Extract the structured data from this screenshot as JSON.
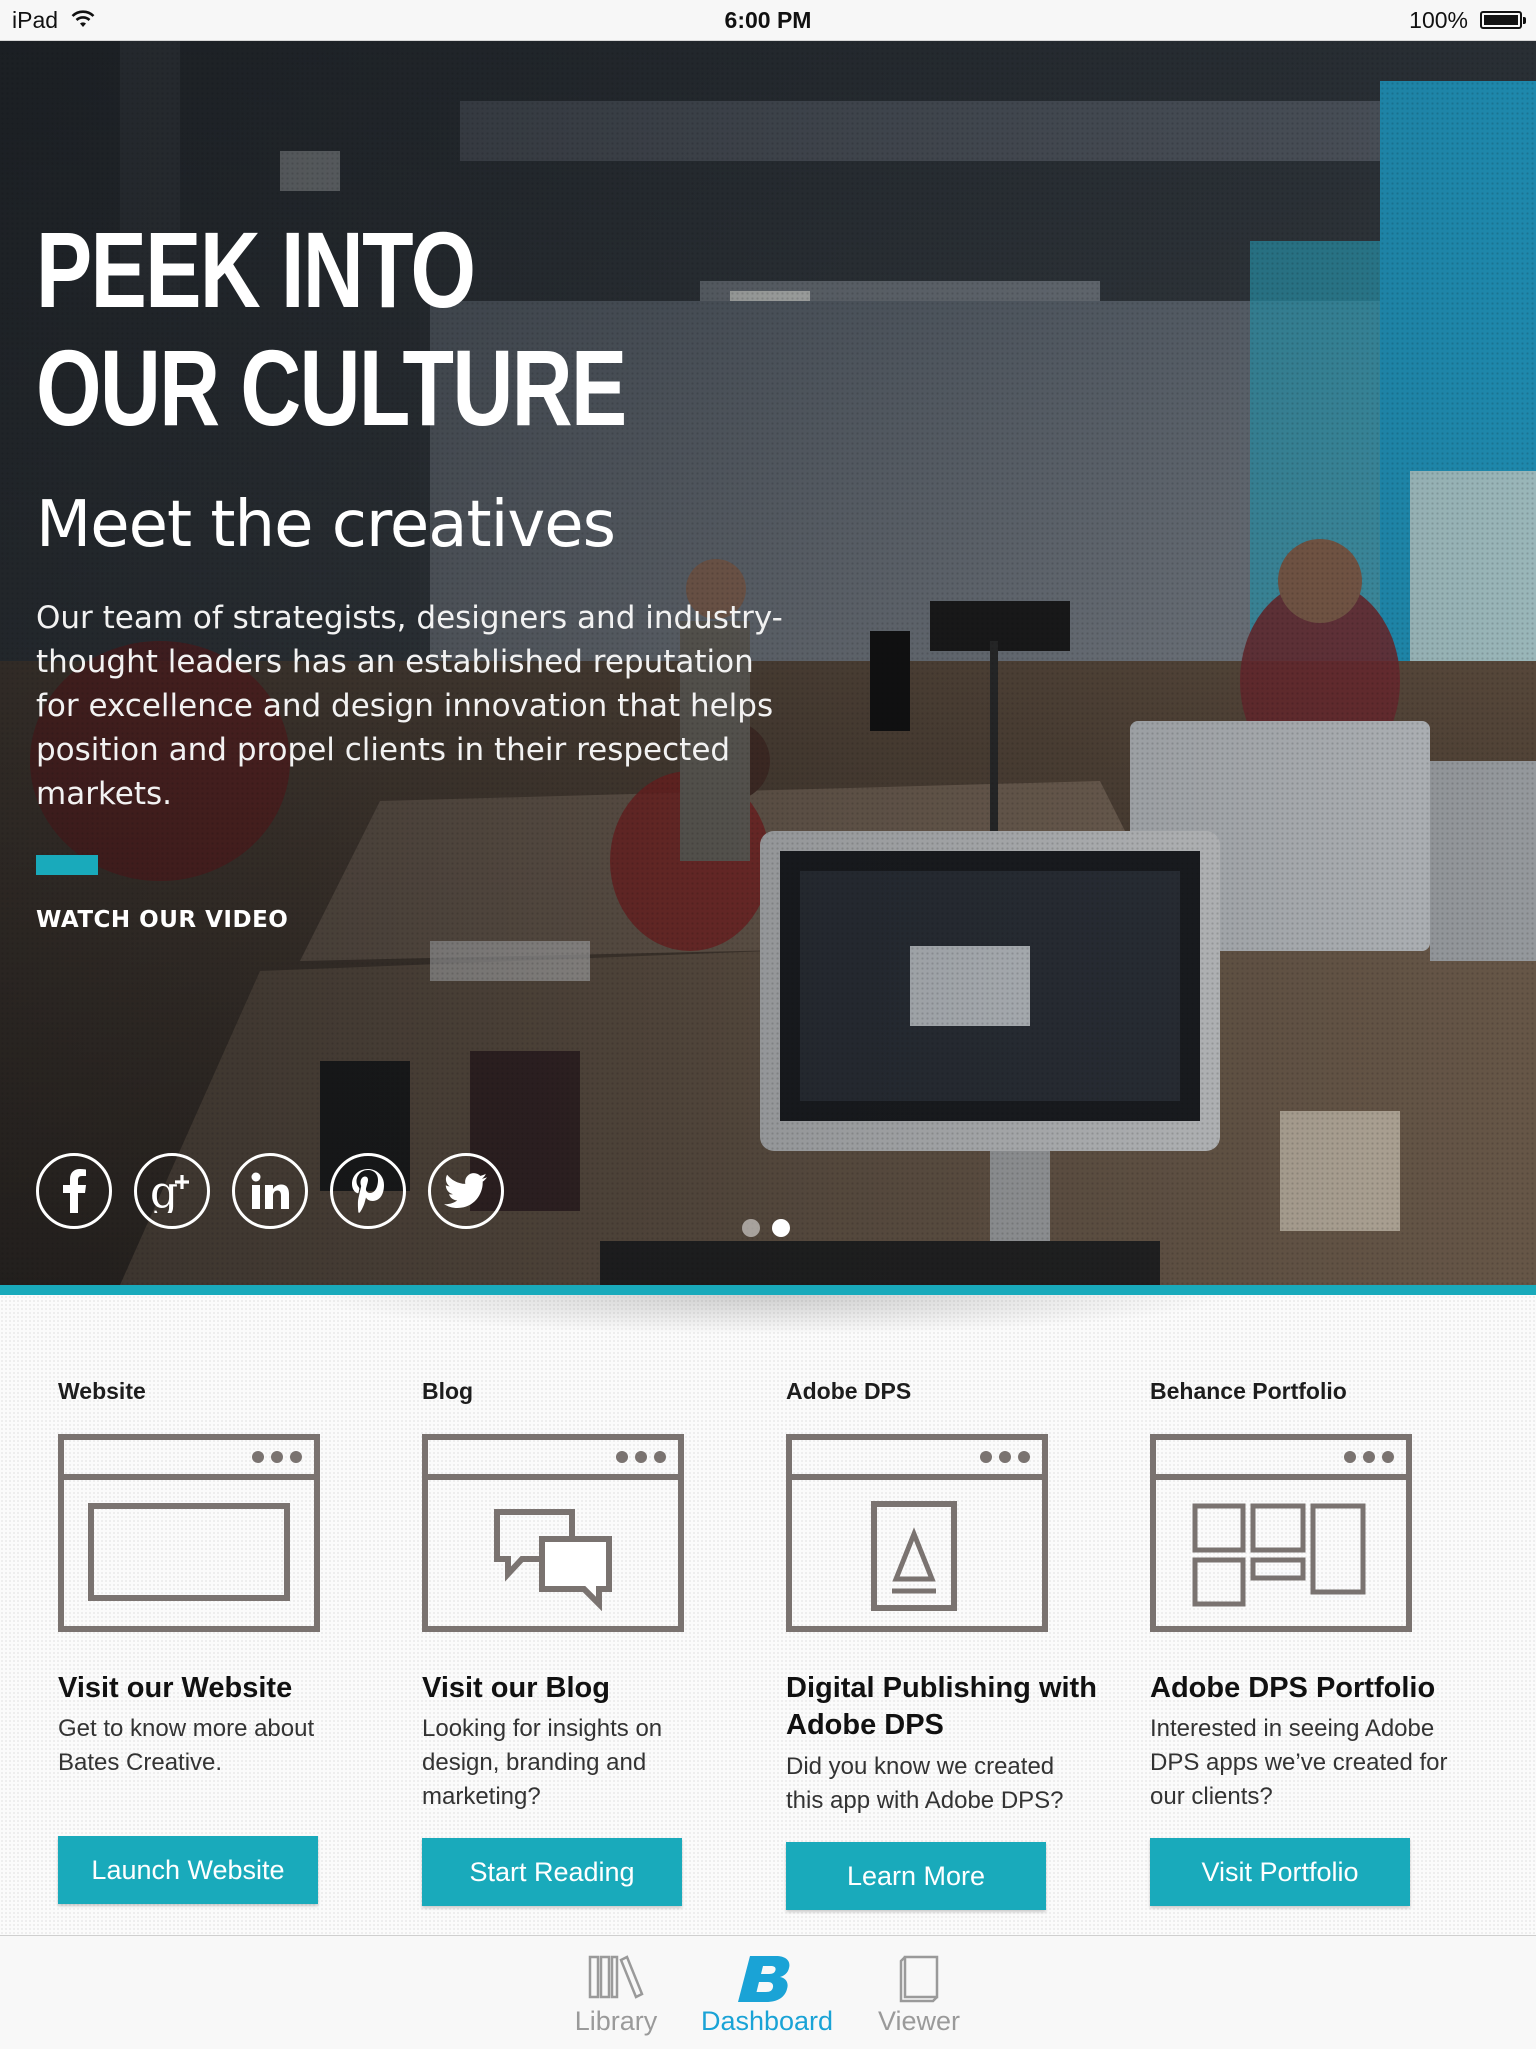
{
  "status_bar": {
    "device": "iPad",
    "time": "6:00 PM",
    "battery": "100%",
    "battery_level": 1.0
  },
  "hero": {
    "title_line1": "PEEK INTO",
    "title_line2": "OUR CULTURE",
    "subtitle": "Meet the creatives",
    "body": "Our team of strategists, designers and industry-thought leaders has an established reputation for excellence and design innovation that helps position and propel clients in their respected markets.",
    "cta": "WATCH OUR VIDEO",
    "social": [
      "facebook-icon",
      "google-plus-icon",
      "linkedin-icon",
      "pinterest-icon",
      "twitter-icon"
    ],
    "pager": {
      "count": 2,
      "active_index": 1
    }
  },
  "cards": [
    {
      "heading": "Website",
      "title": "Visit our Website",
      "description": "Get to know more about Bates Creative.",
      "button": "Launch Website",
      "icon": "browser-window-icon"
    },
    {
      "heading": "Blog",
      "title": "Visit our Blog",
      "description": "Looking for insights on design, branding and marketing?",
      "button": "Start Reading",
      "icon": "chat-bubbles-icon"
    },
    {
      "heading": "Adobe DPS",
      "title": "Digital Publishing with Adobe DPS",
      "description": "Did you know we created this app with Adobe DPS?",
      "button": "Learn More",
      "icon": "document-icon"
    },
    {
      "heading": "Behance Portfolio",
      "title": "Adobe DPS Portfolio",
      "description": "Interested in seeing Adobe DPS apps we’ve created for our clients?",
      "button": "Visit Portfolio",
      "icon": "portfolio-grid-icon"
    }
  ],
  "tabbar": {
    "items": [
      {
        "label": "Library",
        "icon": "library-icon",
        "active": false
      },
      {
        "label": "Dashboard",
        "icon": "b-logo-icon",
        "active": true
      },
      {
        "label": "Viewer",
        "icon": "viewer-icon",
        "active": false
      }
    ]
  },
  "colors": {
    "accent": "#19aabb",
    "tab_active": "#1aa3d6",
    "icon_stroke": "#7a7370"
  }
}
